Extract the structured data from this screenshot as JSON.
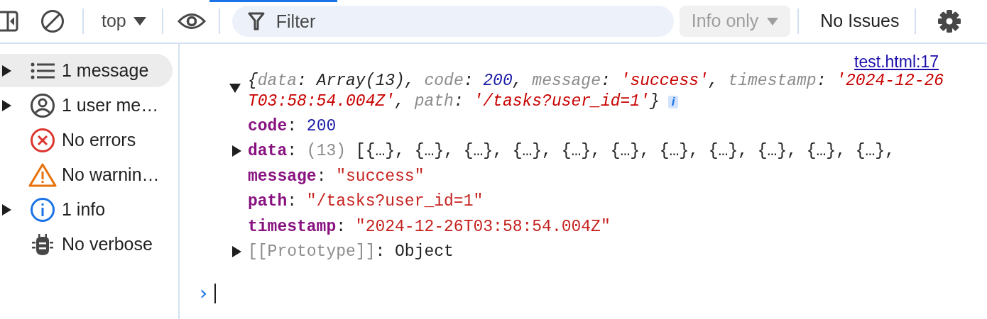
{
  "toolbar": {
    "context": "top",
    "filter": {
      "placeholder": "Filter"
    },
    "level": {
      "label": "Info only",
      "disabled": true
    },
    "issues": "No Issues"
  },
  "sidebar": {
    "items": [
      {
        "label": "1 message",
        "kind": "messages",
        "expandable": true,
        "selected": true
      },
      {
        "label": "1 user me…",
        "kind": "user",
        "expandable": true,
        "selected": false
      },
      {
        "label": "No errors",
        "kind": "error",
        "expandable": false,
        "selected": false
      },
      {
        "label": "No warnin…",
        "kind": "warning",
        "expandable": false,
        "selected": false
      },
      {
        "label": "1 info",
        "kind": "info",
        "expandable": true,
        "selected": false
      },
      {
        "label": "No verbose",
        "kind": "verbose",
        "expandable": false,
        "selected": false
      }
    ]
  },
  "console": {
    "source": "test.html:17",
    "summary": [
      {
        "kind": "punct",
        "text": "{"
      },
      {
        "kind": "key",
        "text": "data"
      },
      {
        "kind": "punct",
        "text": ": "
      },
      {
        "kind": "plain",
        "text": "Array(13)"
      },
      {
        "kind": "punct",
        "text": ", "
      },
      {
        "kind": "key",
        "text": "code"
      },
      {
        "kind": "punct",
        "text": ": "
      },
      {
        "kind": "number",
        "text": "200"
      },
      {
        "kind": "punct",
        "text": ", "
      },
      {
        "kind": "key",
        "text": "message"
      },
      {
        "kind": "punct",
        "text": ": "
      },
      {
        "kind": "string",
        "text": "'success'"
      },
      {
        "kind": "punct",
        "text": ", "
      },
      {
        "kind": "key",
        "text": "timestamp"
      },
      {
        "kind": "punct",
        "text": ": "
      },
      {
        "kind": "string",
        "text": "'2024-12-26T03:58:54.004Z'"
      },
      {
        "kind": "punct",
        "text": ", "
      },
      {
        "kind": "key",
        "text": "path"
      },
      {
        "kind": "punct",
        "text": ": "
      },
      {
        "kind": "string",
        "text": "'/tasks?user_id=1'"
      },
      {
        "kind": "punct",
        "text": "}"
      }
    ],
    "expanded": true,
    "badge": "i",
    "properties": [
      {
        "key": "code",
        "sep": ":",
        "value": "200",
        "kind": "number",
        "expandable": false
      },
      {
        "key": "data",
        "sep": ":",
        "count": "(13)",
        "value": "[{…}, {…}, {…}, {…}, {…}, {…}, {…}, {…}, {…}, {…}, {…},",
        "kind": "plain",
        "expandable": true
      },
      {
        "key": "message",
        "sep": ":",
        "value": "\"success\"",
        "kind": "string",
        "expandable": false
      },
      {
        "key": "path",
        "sep": ":",
        "value": "\"/tasks?user_id=1\"",
        "kind": "string",
        "expandable": false
      },
      {
        "key": "timestamp",
        "sep": ":",
        "value": "\"2024-12-26T03:58:54.004Z\"",
        "kind": "string",
        "expandable": false
      },
      {
        "key": "[[Prototype]]",
        "sep": ":",
        "value": "Object",
        "kind": "proto",
        "expandable": true
      }
    ],
    "prompt": "›"
  }
}
